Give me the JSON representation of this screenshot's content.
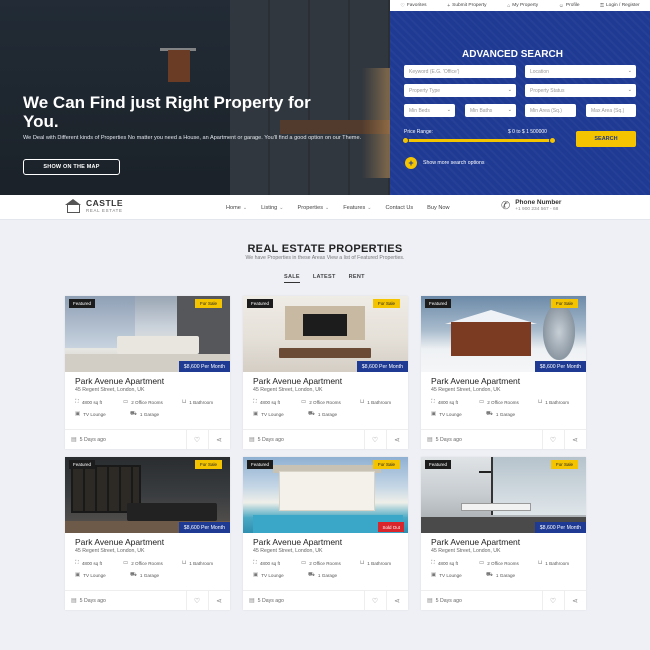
{
  "topbar": {
    "items": [
      {
        "label": "Favorites",
        "icon": "heart-icon"
      },
      {
        "label": "Submit Property",
        "icon": "plus-icon"
      },
      {
        "label": "My Property",
        "icon": "home-icon"
      },
      {
        "label": "Profile",
        "icon": "user-icon"
      },
      {
        "label": "Login / Register",
        "icon": "lock-icon"
      }
    ]
  },
  "hero": {
    "title": "We Can Find just Right Property for You.",
    "subtitle": "We Deal with Different kinds of Properties No matter you need a House, an Apartment or garage. You'll find a good option on our Theme.",
    "map_button": "SHOW ON THE MAP"
  },
  "search": {
    "title": "ADVANCED SEARCH",
    "keyword_placeholder": "Keyword (E.G. 'Office')",
    "location": "Location",
    "property_type": "Property Type",
    "property_status": "Property Status",
    "min_beds": "Min Beds",
    "min_baths": "Min Baths",
    "min_area": "Min Area (Sq.)",
    "max_area": "Max Area (Sq.)",
    "price_label": "Price Range:",
    "price_value": "$ 0 to $ 1 500000",
    "search_button": "SEARCH",
    "more_options": "Show more search options"
  },
  "nav": {
    "logo_name": "CASTLE",
    "logo_tag": "REAL ESTATE",
    "items": [
      "Home",
      "Listing",
      "Properties",
      "Features",
      "Contact Us",
      "Buy Now"
    ],
    "phone_label": "Phone Number",
    "phone_number": "+1 900 234 567 - 68"
  },
  "section": {
    "title": "REAL ESTATE PROPERTIES",
    "subtitle": "We have Properties in these Areas View a list of Featured Properties.",
    "tabs": [
      "SALE",
      "LATEST",
      "RENT"
    ],
    "active_tab": "SALE"
  },
  "cards": [
    {
      "featured": "Featured",
      "status": "For Sale",
      "price": "$8,600 Per Month",
      "title": "Park Avenue Apartment",
      "address": "45 Regent Street, London, UK",
      "area": "4800 sq ft",
      "rooms": "2 Office Rooms",
      "bath": "1 Bathroom",
      "lounge": "TV Lounge",
      "garage": "1 Garage",
      "posted": "5 Days ago",
      "sold": ""
    },
    {
      "featured": "Featured",
      "status": "For Sale",
      "price": "$8,600 Per Month",
      "title": "Park Avenue Apartment",
      "address": "45 Regent Street, London, UK",
      "area": "4800 sq ft",
      "rooms": "2 Office Rooms",
      "bath": "1 Bathroom",
      "lounge": "TV Lounge",
      "garage": "1 Garage",
      "posted": "5 Days ago",
      "sold": ""
    },
    {
      "featured": "Featured",
      "status": "For Sale",
      "price": "$8,600 Per Month",
      "title": "Park Avenue Apartment",
      "address": "45 Regent Street, London, UK",
      "area": "4800 sq ft",
      "rooms": "2 Office Rooms",
      "bath": "1 Bathroom",
      "lounge": "TV Lounge",
      "garage": "1 Garage",
      "posted": "5 Days ago",
      "sold": ""
    },
    {
      "featured": "Featured",
      "status": "For Sale",
      "price": "$8,600 Per Month",
      "title": "Park Avenue Apartment",
      "address": "45 Regent Street, London, UK",
      "area": "4800 sq ft",
      "rooms": "2 Office Rooms",
      "bath": "1 Bathroom",
      "lounge": "TV Lounge",
      "garage": "1 Garage",
      "posted": "5 Days ago",
      "sold": ""
    },
    {
      "featured": "Featured",
      "status": "For Sale",
      "price": "",
      "title": "Park Avenue Apartment",
      "address": "45 Regent Street, London, UK",
      "area": "4800 sq ft",
      "rooms": "2 Office Rooms",
      "bath": "1 Bathroom",
      "lounge": "TV Lounge",
      "garage": "1 Garage",
      "posted": "5 Days ago",
      "sold": "Sold Out"
    },
    {
      "featured": "Featured",
      "status": "For Sale",
      "price": "$8,600 Per Month",
      "title": "Park Avenue Apartment",
      "address": "45 Regent Street, London, UK",
      "area": "4800 sq ft",
      "rooms": "2 Office Rooms",
      "bath": "1 Bathroom",
      "lounge": "TV Lounge",
      "garage": "1 Garage",
      "posted": "5 Days ago",
      "sold": ""
    }
  ],
  "colors": {
    "accent": "#f4c400",
    "brand_blue": "#1e3a93",
    "sold_red": "#d8262c"
  }
}
